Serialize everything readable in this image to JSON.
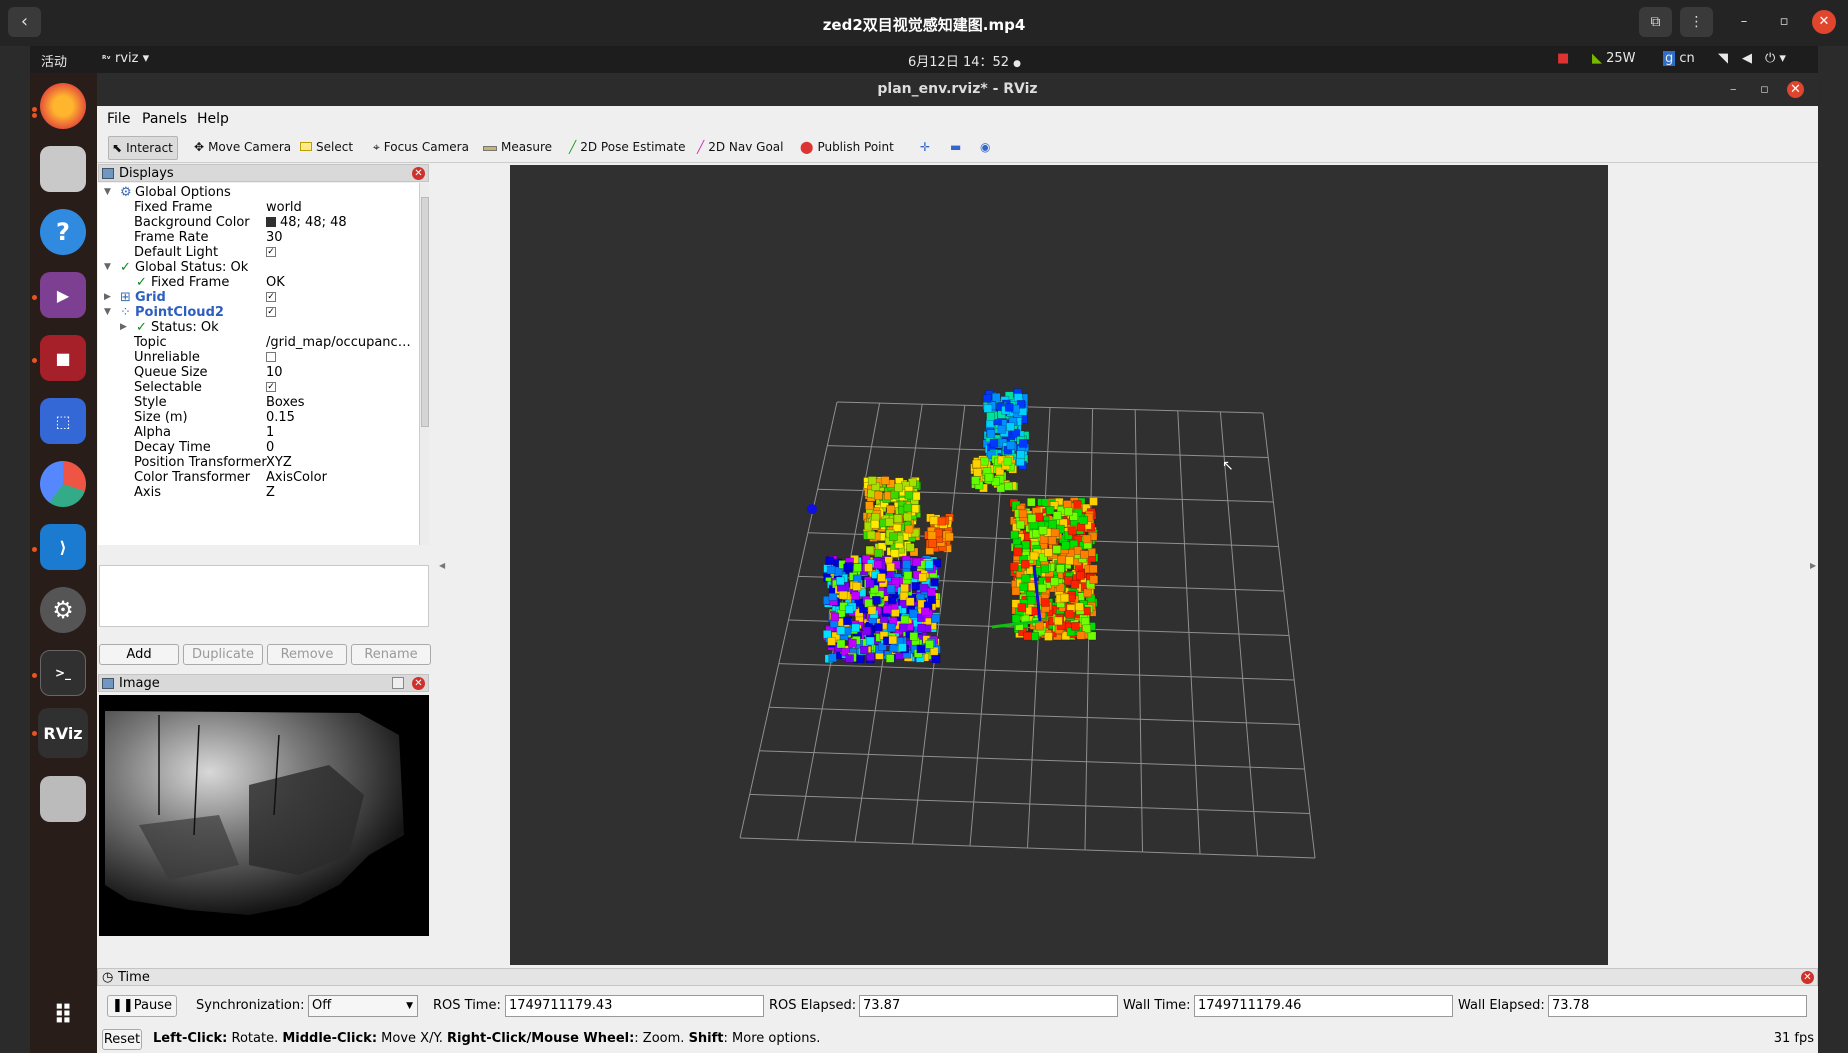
{
  "player": {
    "title": "zed2双目视觉感知建图.mp4",
    "back_icon": "‹"
  },
  "topbar": {
    "activities": "活动",
    "app_name": "rviz",
    "datetime": "6月12日  14：52",
    "power": "25W",
    "input_method": "cn"
  },
  "rviz": {
    "window_title": "plan_env.rviz* - RViz",
    "menu": [
      "File",
      "Panels",
      "Help"
    ],
    "tools": [
      "Interact",
      "Move Camera",
      "Select",
      "Focus Camera",
      "Measure",
      "2D Pose Estimate",
      "2D Nav Goal",
      "Publish Point"
    ],
    "displays_title": "Displays",
    "tree": [
      {
        "key": "Global Options",
        "value": "",
        "indent": 0,
        "expand": "open",
        "icon": "gear-icon",
        "style": ""
      },
      {
        "key": "Fixed Frame",
        "value": "world",
        "indent": 1
      },
      {
        "key": "Background Color",
        "value": "48; 48; 48",
        "indent": 1,
        "swatch": true
      },
      {
        "key": "Frame Rate",
        "value": "30",
        "indent": 1
      },
      {
        "key": "Default Light",
        "value": "",
        "indent": 1,
        "check": true
      },
      {
        "key": "Global Status: Ok",
        "value": "",
        "indent": 0,
        "expand": "open",
        "icon": "check-icon"
      },
      {
        "key": "Fixed Frame",
        "value": "OK",
        "indent": 1,
        "icon": "check-icon"
      },
      {
        "key": "Grid",
        "value": "",
        "indent": 0,
        "expand": "closed",
        "icon": "grid-icon",
        "style": "blue",
        "check": true
      },
      {
        "key": "PointCloud2",
        "value": "",
        "indent": 0,
        "expand": "open",
        "icon": "pointcloud-icon",
        "style": "blue",
        "check": true
      },
      {
        "key": "Status: Ok",
        "value": "",
        "indent": 1,
        "expand": "closed",
        "icon": "check-icon"
      },
      {
        "key": "Topic",
        "value": "/grid_map/occupancy_in...",
        "indent": 1
      },
      {
        "key": "Unreliable",
        "value": "",
        "indent": 1,
        "check": false
      },
      {
        "key": "Queue Size",
        "value": "10",
        "indent": 1
      },
      {
        "key": "Selectable",
        "value": "",
        "indent": 1,
        "check": true
      },
      {
        "key": "Style",
        "value": "Boxes",
        "indent": 1
      },
      {
        "key": "Size (m)",
        "value": "0.15",
        "indent": 1
      },
      {
        "key": "Alpha",
        "value": "1",
        "indent": 1
      },
      {
        "key": "Decay Time",
        "value": "0",
        "indent": 1
      },
      {
        "key": "Position Transformer",
        "value": "XYZ",
        "indent": 1
      },
      {
        "key": "Color Transformer",
        "value": "AxisColor",
        "indent": 1
      },
      {
        "key": "Axis",
        "value": "Z",
        "indent": 1
      }
    ],
    "buttons": {
      "add": "Add",
      "duplicate": "Duplicate",
      "remove": "Remove",
      "rename": "Rename"
    },
    "image_title": "Image",
    "time": {
      "title": "Time",
      "pause": "Pause",
      "sync_label": "Synchronization:",
      "sync_value": "Off",
      "ros_time_label": "ROS Time:",
      "ros_time": "1749711179.43",
      "ros_elapsed_label": "ROS Elapsed:",
      "ros_elapsed": "73.87",
      "wall_time_label": "Wall Time:",
      "wall_time": "1749711179.46",
      "wall_elapsed_label": "Wall Elapsed:",
      "wall_elapsed": "73.78"
    },
    "status": {
      "reset": "Reset",
      "left": "Left-Click:",
      "left_txt": " Rotate. ",
      "middle": "Middle-Click:",
      "middle_txt": " Move X/Y. ",
      "right": "Right-Click/Mouse Wheel:",
      "right_txt": ": Zoom. ",
      "shift": "Shift",
      "shift_txt": ": More options.",
      "fps": "31 fps"
    }
  }
}
